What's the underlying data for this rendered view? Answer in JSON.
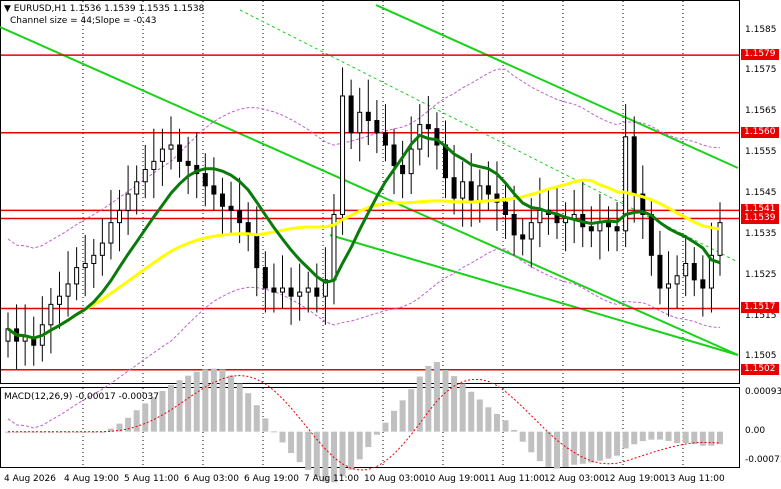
{
  "header": {
    "symbol_line": "EURUSD,H1  1.1536 1.1539 1.1535 1.1538",
    "channel_line": "Channel size = 44;Slope = -0.43"
  },
  "macd": {
    "label": "MACD(12,26,9) -0.00017 -0.00037",
    "axis": [
      "0.00093",
      "0.00",
      "-0.00071"
    ]
  },
  "price_axis": [
    "1.1585",
    "1.1575",
    "1.1565",
    "1.1555",
    "1.1545",
    "1.1535",
    "1.1525",
    "1.1515",
    "1.1505"
  ],
  "level_tags": [
    {
      "label": "1.1579",
      "price": 1.1579
    },
    {
      "label": "1.1560",
      "price": 1.156
    },
    {
      "label": "1.1541",
      "price": 1.1541
    },
    {
      "label": "1.1539",
      "price": 1.1539
    },
    {
      "label": "1.1517",
      "price": 1.1517
    },
    {
      "label": "1.1502",
      "price": 1.1502
    }
  ],
  "time_axis": [
    "4 Aug 2026",
    "4 Aug 19:00",
    "5 Aug 11:00",
    "6 Aug 03:00",
    "6 Aug 19:00",
    "7 Aug 11:00",
    "10 Aug 03:00",
    "10 Aug 19:00",
    "11 Aug 11:00",
    "12 Aug 03:00",
    "12 Aug 19:00",
    "13 Aug 11:00"
  ],
  "colors": {
    "level_line": "#e60000",
    "channel": "#19d219",
    "ma_fast": "#0a7a0a",
    "ma_slow": "#ffff00",
    "envelope": "#c060d0",
    "candle": "#000000",
    "macd_hist": "#c0c0c0",
    "macd_signal": "#e60000"
  },
  "chart_data": {
    "type": "candlestick",
    "price_range": [
      1.1499,
      1.1592
    ],
    "macd_range": [
      -0.00085,
      0.00105
    ],
    "closes": [
      1.1512,
      1.1509,
      1.151,
      1.1508,
      1.1513,
      1.1518,
      1.152,
      1.1523,
      1.1527,
      1.1528,
      1.153,
      1.1533,
      1.1538,
      1.1541,
      1.1545,
      1.1548,
      1.1551,
      1.1553,
      1.1556,
      1.1557,
      1.1553,
      1.1552,
      1.155,
      1.1547,
      1.1545,
      1.1542,
      1.1541,
      1.1538,
      1.1535,
      1.1527,
      1.1522,
      1.1521,
      1.1522,
      1.152,
      1.1521,
      1.1522,
      1.152,
      1.1524,
      1.154,
      1.1569,
      1.156,
      1.1565,
      1.1563,
      1.156,
      1.1557,
      1.1552,
      1.155,
      1.1556,
      1.1562,
      1.1561,
      1.1557,
      1.1549,
      1.1544,
      1.1548,
      1.1543,
      1.1547,
      1.1545,
      1.1543,
      1.154,
      1.1535,
      1.1534,
      1.1538,
      1.1541,
      1.154,
      1.1538,
      1.1539,
      1.154,
      1.1537,
      1.1536,
      1.1538,
      1.1537,
      1.1536,
      1.1559,
      1.1545,
      1.154,
      1.153,
      1.1522,
      1.1523,
      1.1525,
      1.1528,
      1.1524,
      1.1522,
      1.153,
      1.1538
    ],
    "levels": [
      1.1579,
      1.156,
      1.1541,
      1.1539,
      1.1517,
      1.1502
    ]
  }
}
